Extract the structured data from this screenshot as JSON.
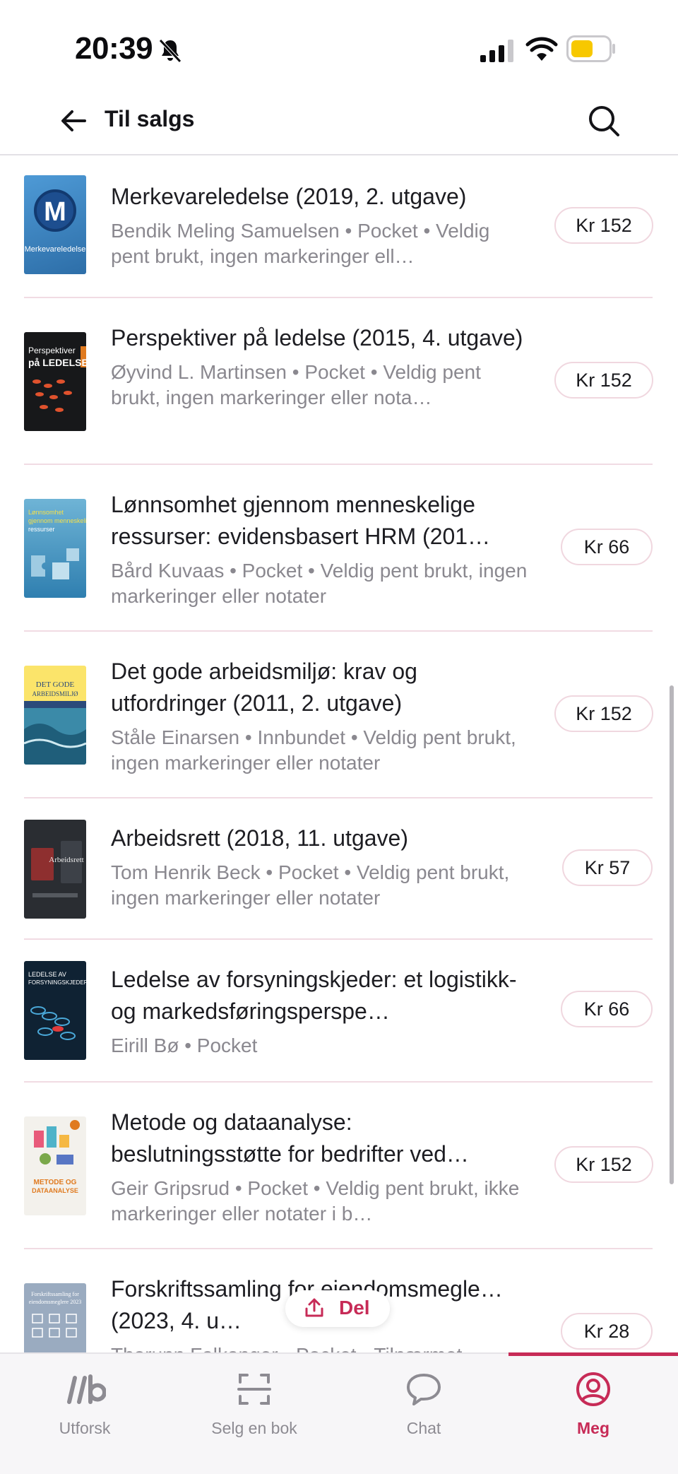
{
  "status_bar": {
    "time": "20:39"
  },
  "header": {
    "title": "Til salgs"
  },
  "items": [
    {
      "title": "Merkevareledelse (2019, 2. utgave)",
      "subtitle": "Bendik Meling Samuelsen • Pocket • Veldig pent brukt, ingen markeringer ell…",
      "price": "Kr 152",
      "cover_text": "Merkevareledelse"
    },
    {
      "title": "Perspektiver på ledelse (2015, 4. utgave)",
      "subtitle": "Øyvind L. Martinsen • Pocket • Veldig pent brukt, ingen markeringer eller nota…",
      "price": "Kr 152",
      "cover_text": "Perspektiver på LEDELSE"
    },
    {
      "title": "Lønnsomhet gjennom menneskelige ressurser: evidensbasert HRM (201…",
      "subtitle": "Bård Kuvaas • Pocket • Veldig pent brukt, ingen markeringer eller notater",
      "price": "Kr 66",
      "cover_text": "Lønnsomhet gjennom menneskelige ressurser"
    },
    {
      "title": "Det gode arbeidsmiljø: krav og utfordringer (2011, 2. utgave)",
      "subtitle": "Ståle Einarsen • Innbundet • Veldig pent brukt, ingen markeringer eller notater",
      "price": "Kr 152",
      "cover_text": "DET GODE ARBEIDSMILJØ"
    },
    {
      "title": "Arbeidsrett (2018, 11. utgave)",
      "subtitle": "Tom Henrik Beck • Pocket • Veldig pent brukt, ingen markeringer eller notater",
      "price": "Kr 57",
      "cover_text": "Arbeidsrett"
    },
    {
      "title": "Ledelse av forsyningskjeder: et logistikk- og markedsføringsperspe…",
      "subtitle": "Eirill Bø • Pocket",
      "price": "Kr 66",
      "cover_text": "LEDELSE AV FORSYNINGSKJEDER"
    },
    {
      "title": "Metode og dataanalyse: beslutningsstøtte for bedrifter ved…",
      "subtitle": "Geir Gripsrud • Pocket • Veldig pent brukt, ikke markeringer eller notater i b…",
      "price": "Kr 152",
      "cover_text": "METODE OG DATAANALYSE"
    },
    {
      "title": "Forskriftssamling for eiendomsmegle… (2023, 4. u…",
      "subtitle": "Thorunn Falkanger • Pocket • Tilnærmet…",
      "price": "Kr 28",
      "cover_text": "Forskriftssamling for eiendomsmeglere 2023"
    }
  ],
  "share": {
    "label": "Del"
  },
  "tabs": [
    {
      "label": "Utforsk"
    },
    {
      "label": "Selg en bok"
    },
    {
      "label": "Chat"
    },
    {
      "label": "Meg"
    }
  ],
  "colors": {
    "accent": "#c72b57",
    "divider": "#f1dbe3",
    "muted_text": "#8a888f"
  }
}
